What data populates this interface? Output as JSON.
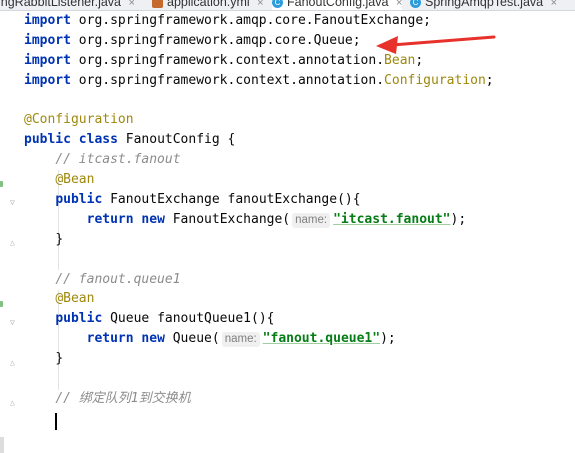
{
  "tabs": [
    {
      "label": "ingRabbitListener.java",
      "icon": "java-class-icon",
      "active": false
    },
    {
      "label": "application.yml",
      "icon": "yml-file-icon",
      "active": false
    },
    {
      "label": "FanoutConfig.java",
      "icon": "java-class-icon",
      "active": true
    },
    {
      "label": "SpringAmqpTest.java",
      "icon": "java-class-icon",
      "active": false
    }
  ],
  "code": {
    "import_kw": "import",
    "imports": [
      "org.springframework.amqp.core.FanoutExchange;",
      "org.springframework.amqp.core.Queue;",
      "org.springframework.context.annotation.",
      "org.springframework.context.annotation."
    ],
    "import3_class": "Bean",
    "import4_class": "Configuration",
    "semicolon": ";",
    "configuration_ann": "@Configuration",
    "public_kw": "public",
    "class_kw": "class",
    "class_decl": "FanoutConfig {",
    "comment1": "// itcast.fanout",
    "bean_ann": "@Bean",
    "method1_sig": "FanoutExchange fanoutExchange(){",
    "return_kw": "return",
    "new_kw": "new",
    "ctor1": "FanoutExchange(",
    "hint_name": "name:",
    "str1": "\"itcast.fanout\"",
    "close_paren": ");",
    "close_brace": "}",
    "comment2": "// fanout.queue1",
    "method2_sig": "Queue fanoutQueue1(){",
    "ctor2": "Queue(",
    "str2": "\"fanout.queue1\"",
    "comment3": "// 绑定队列1到交换机"
  },
  "colors": {
    "keyword": "#0033b3",
    "annotation": "#9e880d",
    "string": "#067d17",
    "comment": "#8c8c8c",
    "arrow": "#e8312a"
  }
}
